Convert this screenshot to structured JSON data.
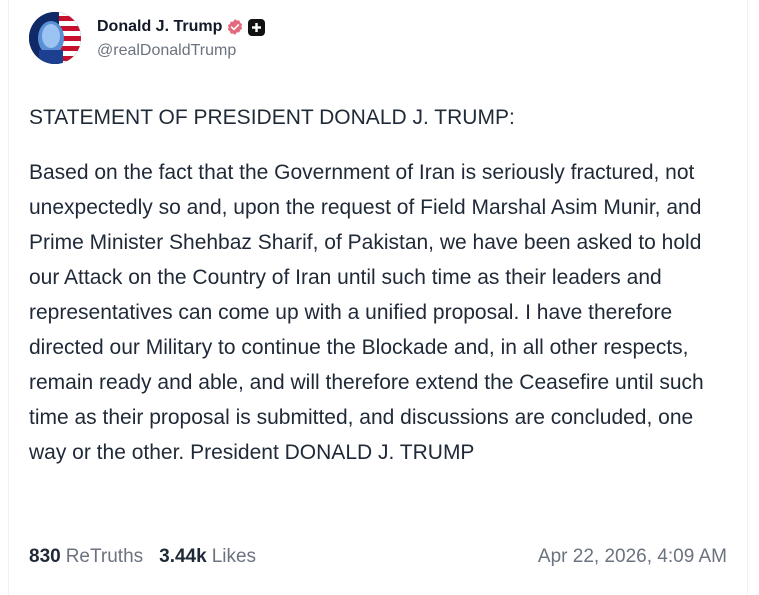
{
  "author": {
    "display_name": "Donald J. Trump",
    "handle": "@realDonaldTrump"
  },
  "post": {
    "title": "STATEMENT OF PRESIDENT DONALD J. TRUMP:",
    "body": "Based on the fact that the Government of Iran is seriously fractured, not unexpectedly so and, upon the request of Field Marshal Asim Munir, and Prime Minister Shehbaz Sharif, of Pakistan, we have been asked to hold our Attack on the Country of Iran until such time as their leaders and representatives can come up with a unified proposal. I have therefore directed our Military to continue the Blockade and, in all other respects, remain ready and able, and will therefore extend the Ceasefire until such time as their proposal is submitted, and discussions are concluded, one way or the other. President DONALD J. TRUMP"
  },
  "stats": {
    "retruths_count": "830",
    "retruths_label": "ReTruths",
    "likes_count": "3.44k",
    "likes_label": "Likes"
  },
  "timestamp": "Apr 22, 2026, 4:09 AM",
  "icons": {
    "verified": "verified-badge-icon",
    "plus": "plus-badge-icon"
  },
  "colors": {
    "verified_badge": "#e36a7c",
    "avatar_blue": "#1c3f8f",
    "avatar_red": "#c8102e"
  }
}
